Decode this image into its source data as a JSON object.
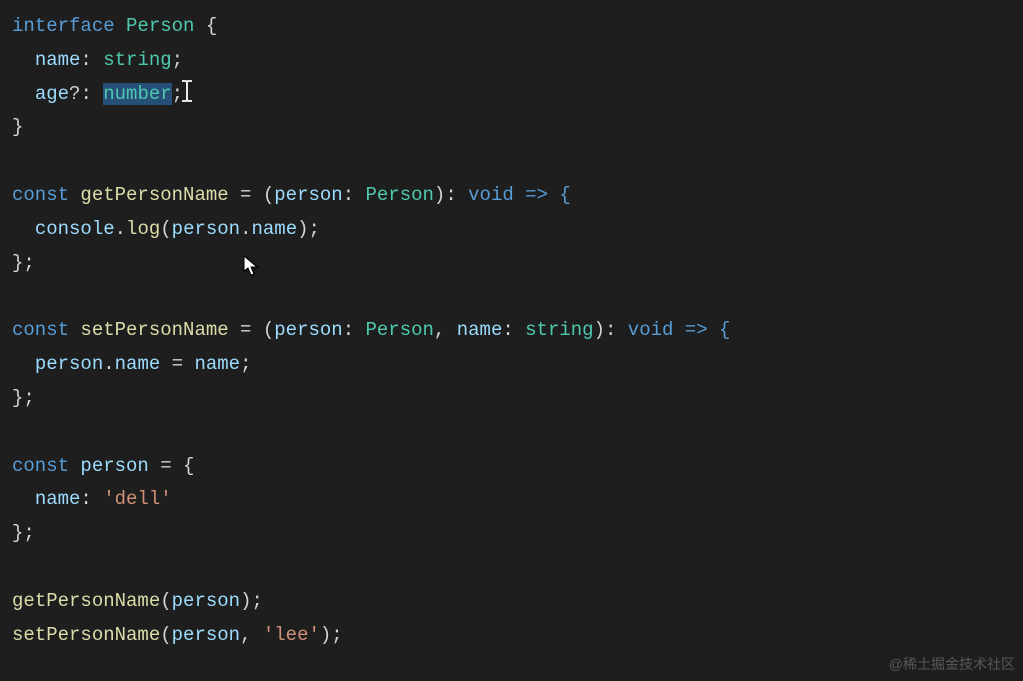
{
  "code": {
    "line1": {
      "kw": "interface",
      "name": "Person",
      "brace": " {"
    },
    "line2": {
      "indent": "  ",
      "prop": "name",
      "colon": ": ",
      "type": "string",
      "semi": ";"
    },
    "line3": {
      "indent": "  ",
      "prop": "age",
      "opt": "?",
      "colon": ": ",
      "type": "number",
      "semi": ";"
    },
    "line4": {
      "brace": "}"
    },
    "line5": "",
    "line6": {
      "kw": "const",
      "fn": "getPersonName",
      "eq": " = (",
      "p1": "person",
      "colon1": ": ",
      "t1": "Person",
      "close": "): ",
      "ret": "void",
      "arrow": " => {"
    },
    "line7": {
      "indent": "  ",
      "obj": "console",
      "dot": ".",
      "method": "log",
      "open": "(",
      "arg1": "person",
      "dot2": ".",
      "arg2": "name",
      "close": ");"
    },
    "line8": {
      "brace": "};"
    },
    "line9": "",
    "line10": {
      "kw": "const",
      "fn": "setPersonName",
      "eq": " = (",
      "p1": "person",
      "colon1": ": ",
      "t1": "Person",
      "comma": ", ",
      "p2": "name",
      "colon2": ": ",
      "t2": "string",
      "close": "): ",
      "ret": "void",
      "arrow": " => {"
    },
    "line11": {
      "indent": "  ",
      "obj": "person",
      "dot": ".",
      "prop": "name",
      "eq": " = ",
      "val": "name",
      "semi": ";"
    },
    "line12": {
      "brace": "};"
    },
    "line13": "",
    "line14": {
      "kw": "const",
      "var": "person",
      "eq": " = {"
    },
    "line15": {
      "indent": "  ",
      "prop": "name",
      "colon": ": ",
      "str": "'dell'"
    },
    "line16": {
      "brace": "};"
    },
    "line17": "",
    "line18": {
      "fn": "getPersonName",
      "open": "(",
      "arg": "person",
      "close": ");"
    },
    "line19": {
      "fn": "setPersonName",
      "open": "(",
      "arg1": "person",
      "comma": ", ",
      "arg2": "'lee'",
      "close": ");"
    }
  },
  "watermark": "@稀土掘金技术社区"
}
